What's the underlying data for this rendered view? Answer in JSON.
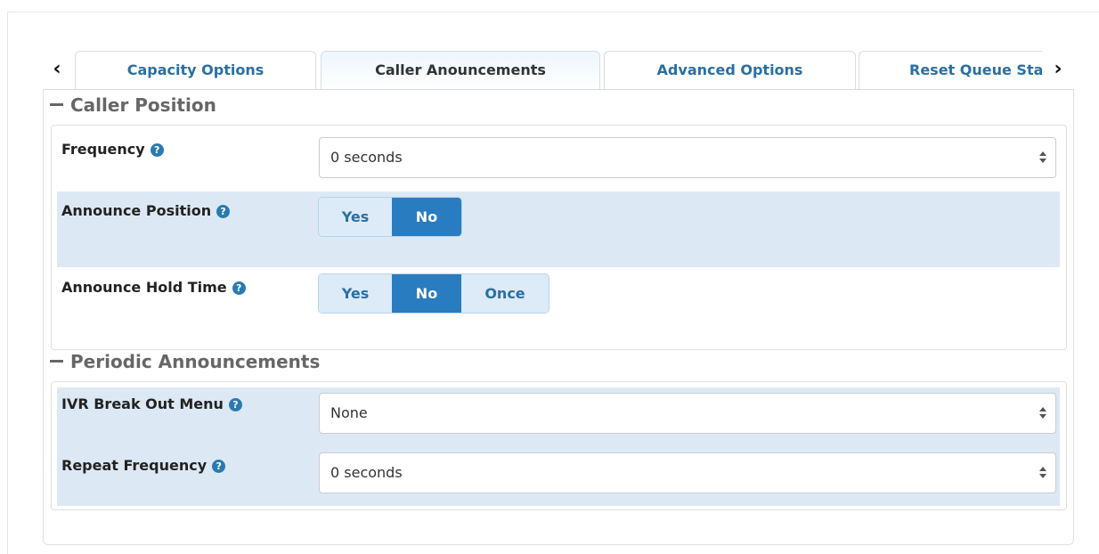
{
  "tabs": [
    {
      "label": "Capacity Options",
      "active": false
    },
    {
      "label": "Caller Anouncements",
      "active": true
    },
    {
      "label": "Advanced Options",
      "active": false
    },
    {
      "label": "Reset Queue Sta",
      "active": false
    }
  ],
  "nav": {
    "prev_icon": "chevron-left-icon",
    "next_icon": "chevron-right-icon",
    "prev_glyph": "‹",
    "next_glyph": "›"
  },
  "help_glyph": "?",
  "sections": {
    "caller_position": {
      "title": "Caller Position",
      "frequency": {
        "label": "Frequency",
        "value": "0 seconds"
      },
      "announce_position": {
        "label": "Announce Position",
        "options": [
          "Yes",
          "No"
        ],
        "selected": "No"
      },
      "announce_hold_time": {
        "label": "Announce Hold Time",
        "options": [
          "Yes",
          "No",
          "Once"
        ],
        "selected": "No"
      }
    },
    "periodic_announcements": {
      "title": "Periodic Announcements",
      "ivr_break_out_menu": {
        "label": "IVR Break Out Menu",
        "value": "None"
      },
      "repeat_frequency": {
        "label": "Repeat Frequency",
        "value": "0 seconds"
      }
    }
  },
  "colors": {
    "accent": "#2a7cc0",
    "tab_text": "#2a6fa3",
    "row_highlight": "#dce9f4",
    "segment_bg": "#dcebf7"
  }
}
